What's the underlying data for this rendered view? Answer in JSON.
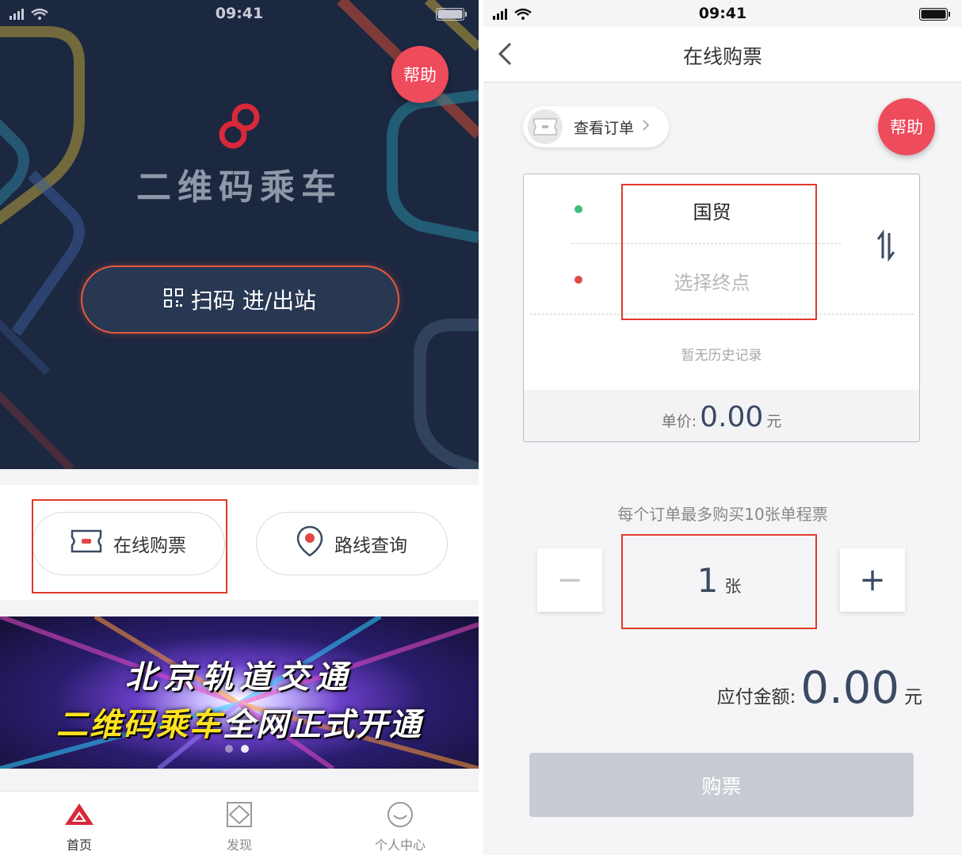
{
  "left_screen": {
    "status_bar": {
      "time": "09:41"
    },
    "help_label": "帮助",
    "app_title": "二维码乘车",
    "scan_button_label": "扫码 进/出站",
    "quick_actions": [
      {
        "label": "在线购票",
        "icon": "ticket-icon"
      },
      {
        "label": "路线查询",
        "icon": "location-pin-icon"
      }
    ],
    "banner": {
      "line1": "北京轨道交通",
      "line2_highlight": "二维码乘车",
      "line2_rest": "全网正式开通",
      "page_count": 2,
      "active_page": 2
    },
    "tabbar": [
      {
        "label": "首页",
        "icon": "home-triangle-icon",
        "active": true
      },
      {
        "label": "发现",
        "icon": "discover-diamond-icon",
        "active": false
      },
      {
        "label": "个人中心",
        "icon": "smiley-face-icon",
        "active": false
      }
    ]
  },
  "right_screen": {
    "status_bar": {
      "time": "09:41"
    },
    "nav_title": "在线购票",
    "view_orders_label": "查看订单",
    "help_label": "帮助",
    "from_station": "国贸",
    "to_placeholder": "选择终点",
    "no_history": "暂无历史记录",
    "unit_price_label": "单价:",
    "unit_price_value": "0.00",
    "currency": "元",
    "purchase_limit": "每个订单最多购买10张单程票",
    "quantity_value": "1",
    "quantity_unit": "张",
    "minus_label": "−",
    "plus_label": "+",
    "total_label": "应付金额:",
    "total_value": "0.00",
    "buy_button_label": "购票"
  },
  "colors": {
    "hero_bg": "#1c2740",
    "help_red": "#ee4b5b",
    "scan_border": "#e55a3c",
    "highlight_red": "#e0392b",
    "value_navy": "#3b4a63",
    "disabled_btn": "#c7ccd3",
    "from_dot": "#3bbf7a",
    "to_dot": "#e04848"
  }
}
